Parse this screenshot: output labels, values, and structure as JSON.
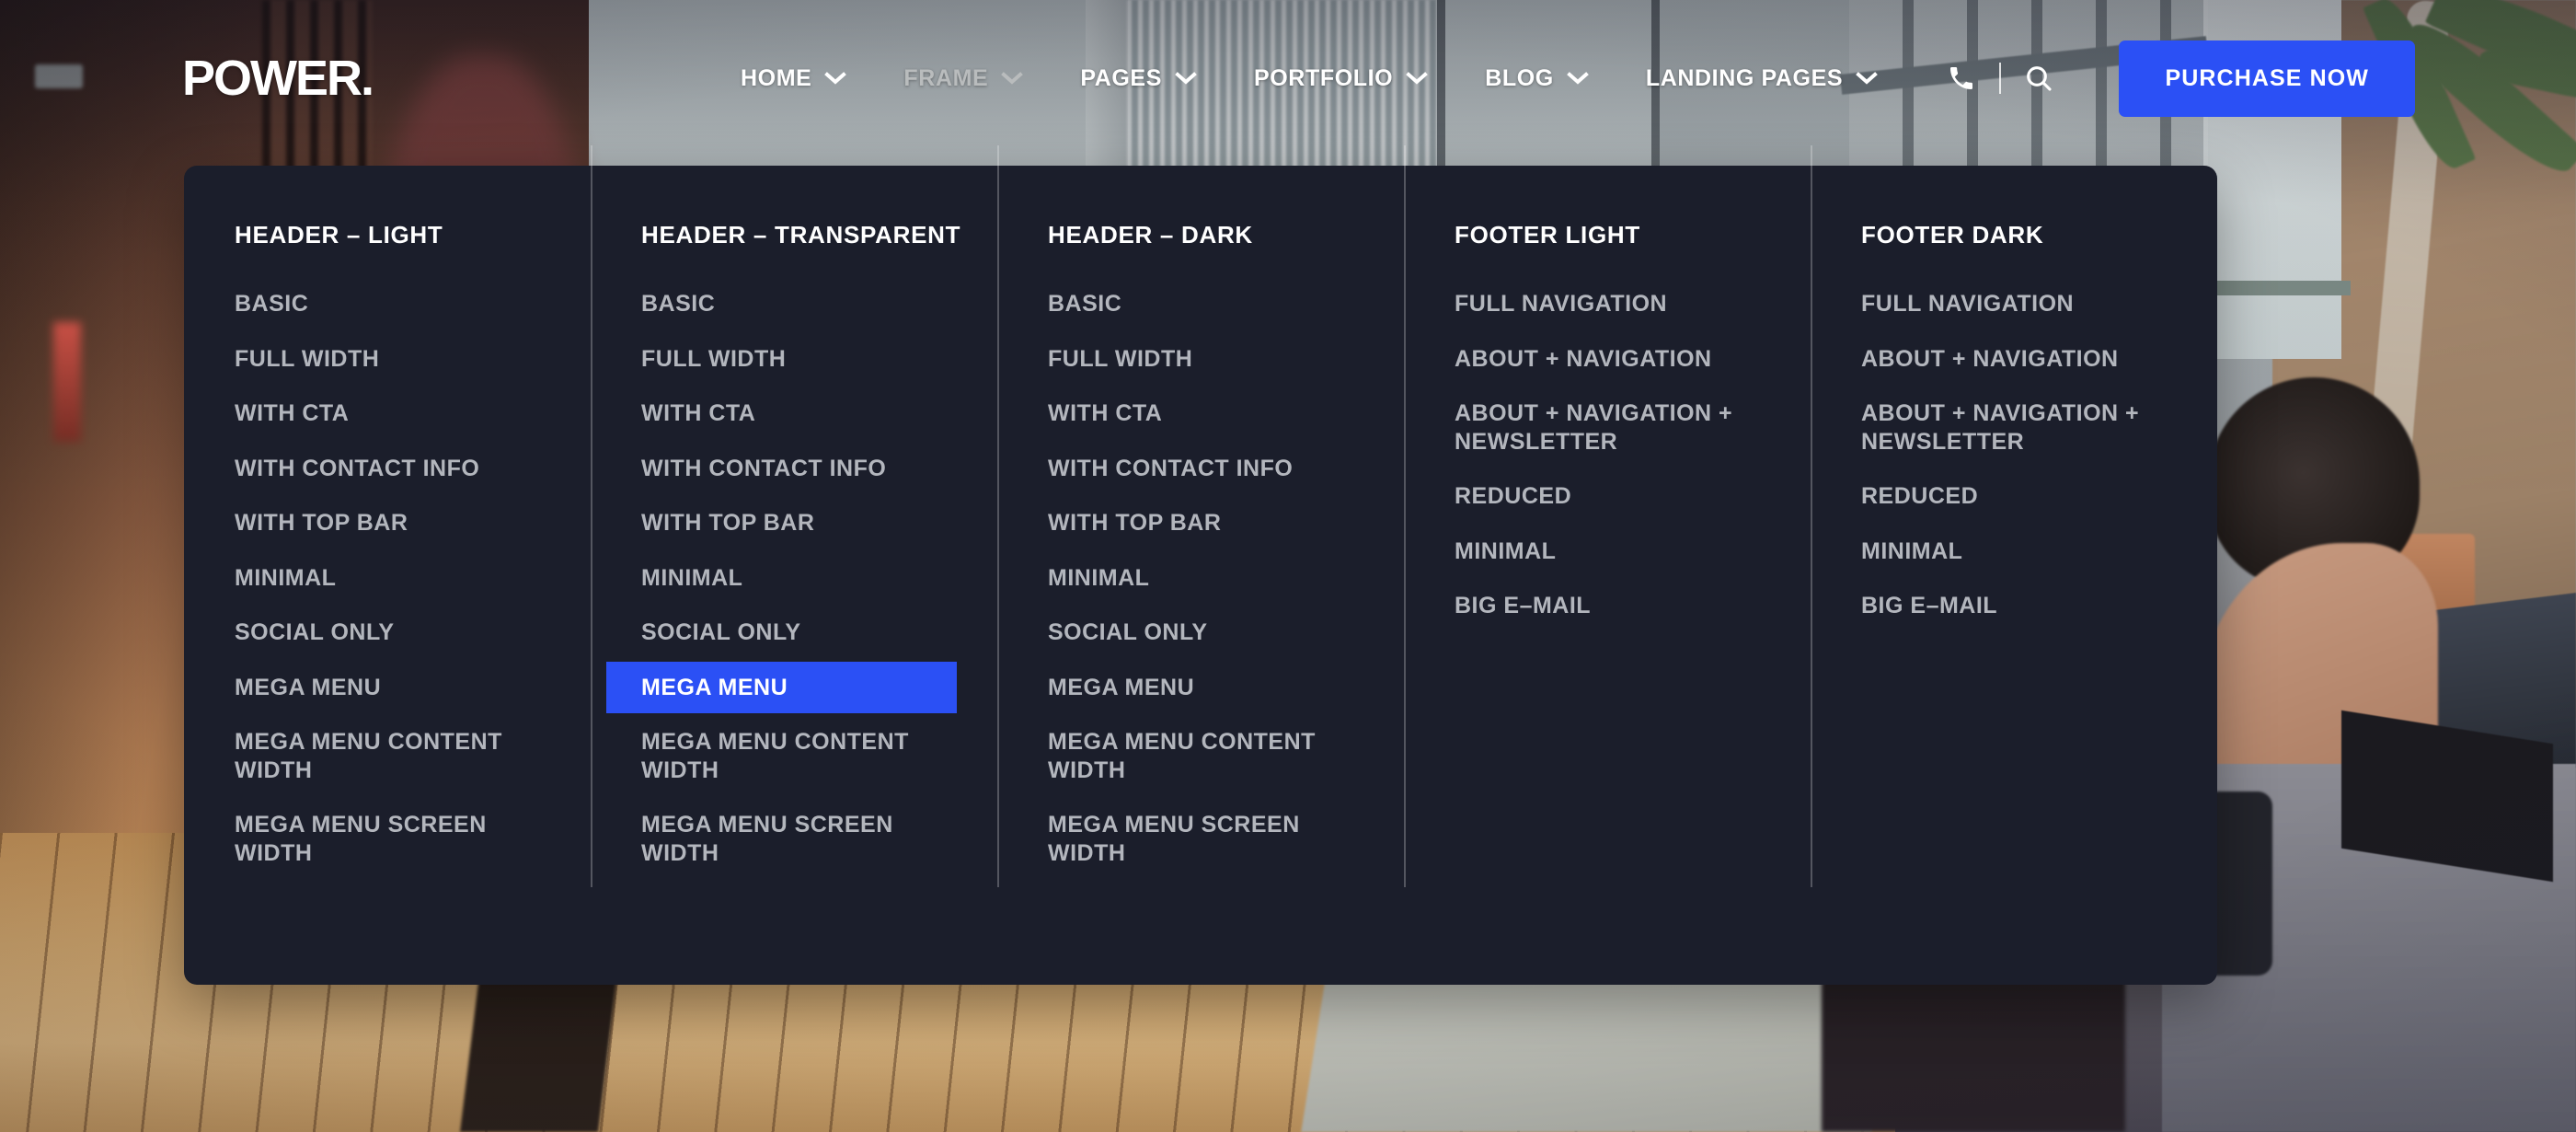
{
  "brand": {
    "logo": "POWER."
  },
  "header": {
    "nav": [
      {
        "label": "HOME",
        "icon": "chevron-down-icon",
        "dim": false
      },
      {
        "label": "FRAME",
        "icon": "chevron-down-icon",
        "dim": true
      },
      {
        "label": "PAGES",
        "icon": "chevron-down-icon",
        "dim": false
      },
      {
        "label": "PORTFOLIO",
        "icon": "chevron-down-icon",
        "dim": false
      },
      {
        "label": "BLOG",
        "icon": "chevron-down-icon",
        "dim": false
      },
      {
        "label": "LANDING PAGES",
        "icon": "chevron-down-icon",
        "dim": false
      }
    ],
    "phone_icon": "phone-icon",
    "search_icon": "search-icon",
    "cta_label": "PURCHASE NOW"
  },
  "colors": {
    "accent": "#2B50F5",
    "panel_bg": "#1B1E2B",
    "link": "#B3B6BD",
    "title": "#FFFFFF"
  },
  "megamenu": {
    "columns": [
      {
        "title": "HEADER – LIGHT",
        "items": [
          {
            "label": "BASIC",
            "active": false
          },
          {
            "label": "FULL WIDTH",
            "active": false
          },
          {
            "label": "WITH CTA",
            "active": false
          },
          {
            "label": "WITH CONTACT INFO",
            "active": false
          },
          {
            "label": "WITH TOP BAR",
            "active": false
          },
          {
            "label": "MINIMAL",
            "active": false
          },
          {
            "label": "SOCIAL ONLY",
            "active": false
          },
          {
            "label": "MEGA MENU",
            "active": false
          },
          {
            "label": "MEGA MENU CONTENT WIDTH",
            "active": false
          },
          {
            "label": "MEGA MENU SCREEN WIDTH",
            "active": false
          }
        ]
      },
      {
        "title": "HEADER – TRANSPARENT",
        "items": [
          {
            "label": "BASIC",
            "active": false
          },
          {
            "label": "FULL WIDTH",
            "active": false
          },
          {
            "label": "WITH CTA",
            "active": false
          },
          {
            "label": "WITH CONTACT INFO",
            "active": false
          },
          {
            "label": "WITH TOP BAR",
            "active": false
          },
          {
            "label": "MINIMAL",
            "active": false
          },
          {
            "label": "SOCIAL ONLY",
            "active": false
          },
          {
            "label": "MEGA MENU",
            "active": true
          },
          {
            "label": "MEGA MENU CONTENT WIDTH",
            "active": false
          },
          {
            "label": "MEGA MENU SCREEN WIDTH",
            "active": false
          }
        ]
      },
      {
        "title": "HEADER – DARK",
        "items": [
          {
            "label": "BASIC",
            "active": false
          },
          {
            "label": "FULL WIDTH",
            "active": false
          },
          {
            "label": "WITH CTA",
            "active": false
          },
          {
            "label": "WITH CONTACT INFO",
            "active": false
          },
          {
            "label": "WITH TOP BAR",
            "active": false
          },
          {
            "label": "MINIMAL",
            "active": false
          },
          {
            "label": "SOCIAL ONLY",
            "active": false
          },
          {
            "label": "MEGA MENU",
            "active": false
          },
          {
            "label": "MEGA MENU CONTENT WIDTH",
            "active": false
          },
          {
            "label": "MEGA MENU SCREEN WIDTH",
            "active": false
          }
        ]
      },
      {
        "title": "FOOTER LIGHT",
        "items": [
          {
            "label": "FULL NAVIGATION",
            "active": false
          },
          {
            "label": "ABOUT + NAVIGATION",
            "active": false
          },
          {
            "label": "ABOUT + NAVIGATION + NEWSLETTER",
            "active": false
          },
          {
            "label": "REDUCED",
            "active": false
          },
          {
            "label": "MINIMAL",
            "active": false
          },
          {
            "label": "BIG E–MAIL",
            "active": false
          }
        ]
      },
      {
        "title": "FOOTER DARK",
        "items": [
          {
            "label": "FULL NAVIGATION",
            "active": false
          },
          {
            "label": "ABOUT + NAVIGATION",
            "active": false
          },
          {
            "label": "ABOUT + NAVIGATION + NEWSLETTER",
            "active": false
          },
          {
            "label": "REDUCED",
            "active": false
          },
          {
            "label": "MINIMAL",
            "active": false
          },
          {
            "label": "BIG E–MAIL",
            "active": false
          }
        ]
      }
    ]
  }
}
